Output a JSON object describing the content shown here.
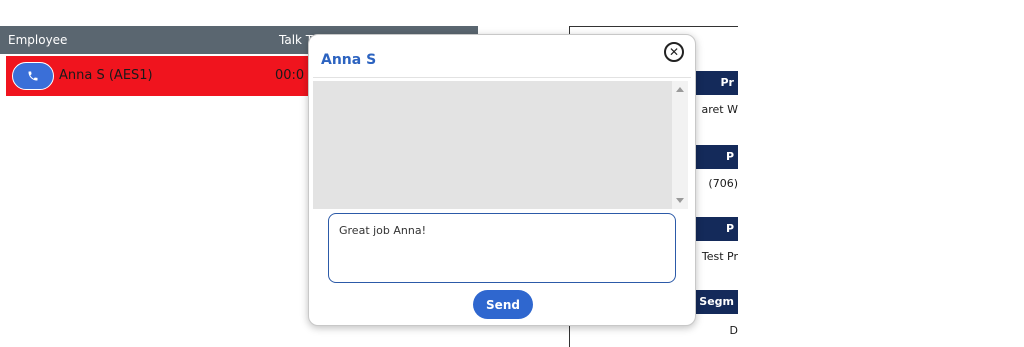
{
  "table": {
    "headers": {
      "employee": "Employee",
      "talk_time": "Talk T"
    },
    "rows": [
      {
        "name": "Anna S (AES1)",
        "talk_time": "00:0",
        "status_color": "#f0141e"
      }
    ]
  },
  "right_panel": {
    "sections": [
      {
        "label": "Pr",
        "value": "aret W"
      },
      {
        "label": "P",
        "value": "(706)"
      },
      {
        "label": "P",
        "value": "Test Pr"
      },
      {
        "label": "Segm",
        "value": "D"
      }
    ]
  },
  "modal": {
    "title": "Anna S",
    "close_glyph": "✕",
    "message_value": "Great job Anna!",
    "send_label": "Send"
  },
  "colors": {
    "header_bg": "#5a6670",
    "row_alert": "#f0141e",
    "accent_blue": "#2f67cf",
    "panel_navy": "#142a5a"
  },
  "icons": {
    "call": "phone-icon",
    "close": "close-icon"
  }
}
